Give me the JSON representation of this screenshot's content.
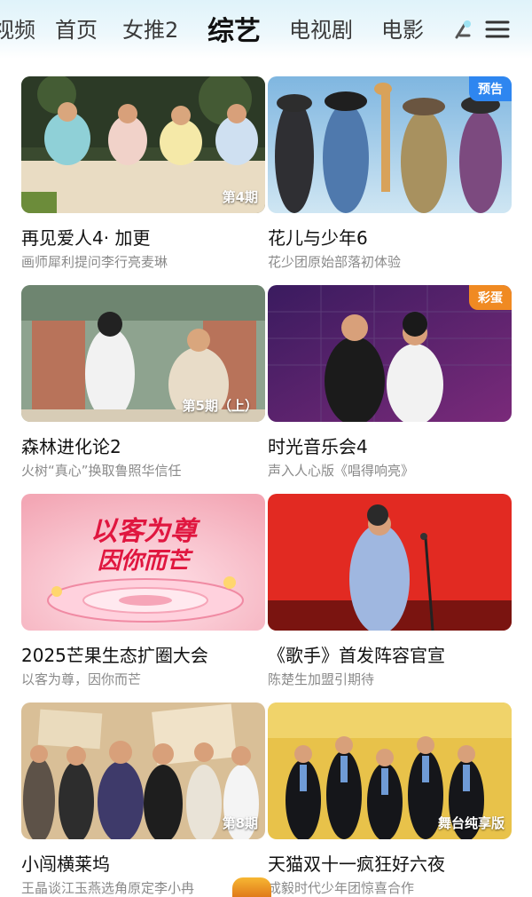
{
  "nav": {
    "tabs": [
      {
        "label": "视频"
      },
      {
        "label": "首页"
      },
      {
        "label": "女推2"
      },
      {
        "label": "综艺",
        "active": true
      },
      {
        "label": "电视剧"
      },
      {
        "label": "电影"
      }
    ],
    "icons": [
      "lamp-icon",
      "menu-icon"
    ]
  },
  "cards": [
    {
      "title": "再见爱人4· 加更",
      "subtitle": "画师犀利提问李行亮麦琳",
      "episode": "第4期",
      "tag": ""
    },
    {
      "title": "花儿与少年6",
      "subtitle": "花少团原始部落初体验",
      "episode": "",
      "tag": "预告"
    },
    {
      "title": "森林进化论2",
      "subtitle": "火树“真心”换取鲁照华信任",
      "episode": "第5期（上）",
      "tag": ""
    },
    {
      "title": "时光音乐会4",
      "subtitle": "声入人心版《唱得响亮》",
      "episode": "",
      "tag": "彩蛋"
    },
    {
      "title": "2025芒果生态扩圈大会",
      "subtitle": "以客为尊，因你而芒",
      "episode": "",
      "tag": ""
    },
    {
      "title": "《歌手》首发阵容官宣",
      "subtitle": "陈楚生加盟引期待",
      "episode": "",
      "tag": ""
    },
    {
      "title": "小闯横莱坞",
      "subtitle": "王晶谈江玉燕选角原定李小冉",
      "episode": "第8期",
      "tag": ""
    },
    {
      "title": "天猫双十一疯狂好六夜",
      "subtitle": "成毅时代少年团惊喜合作",
      "episode": "舞台纯享版",
      "tag": ""
    }
  ],
  "poster_text": {
    "card5_line1": "以客为尊",
    "card5_line2": "因你而芒"
  },
  "colors": {
    "tag_blue": "#2e86f0",
    "tag_orange": "#f08a22"
  }
}
